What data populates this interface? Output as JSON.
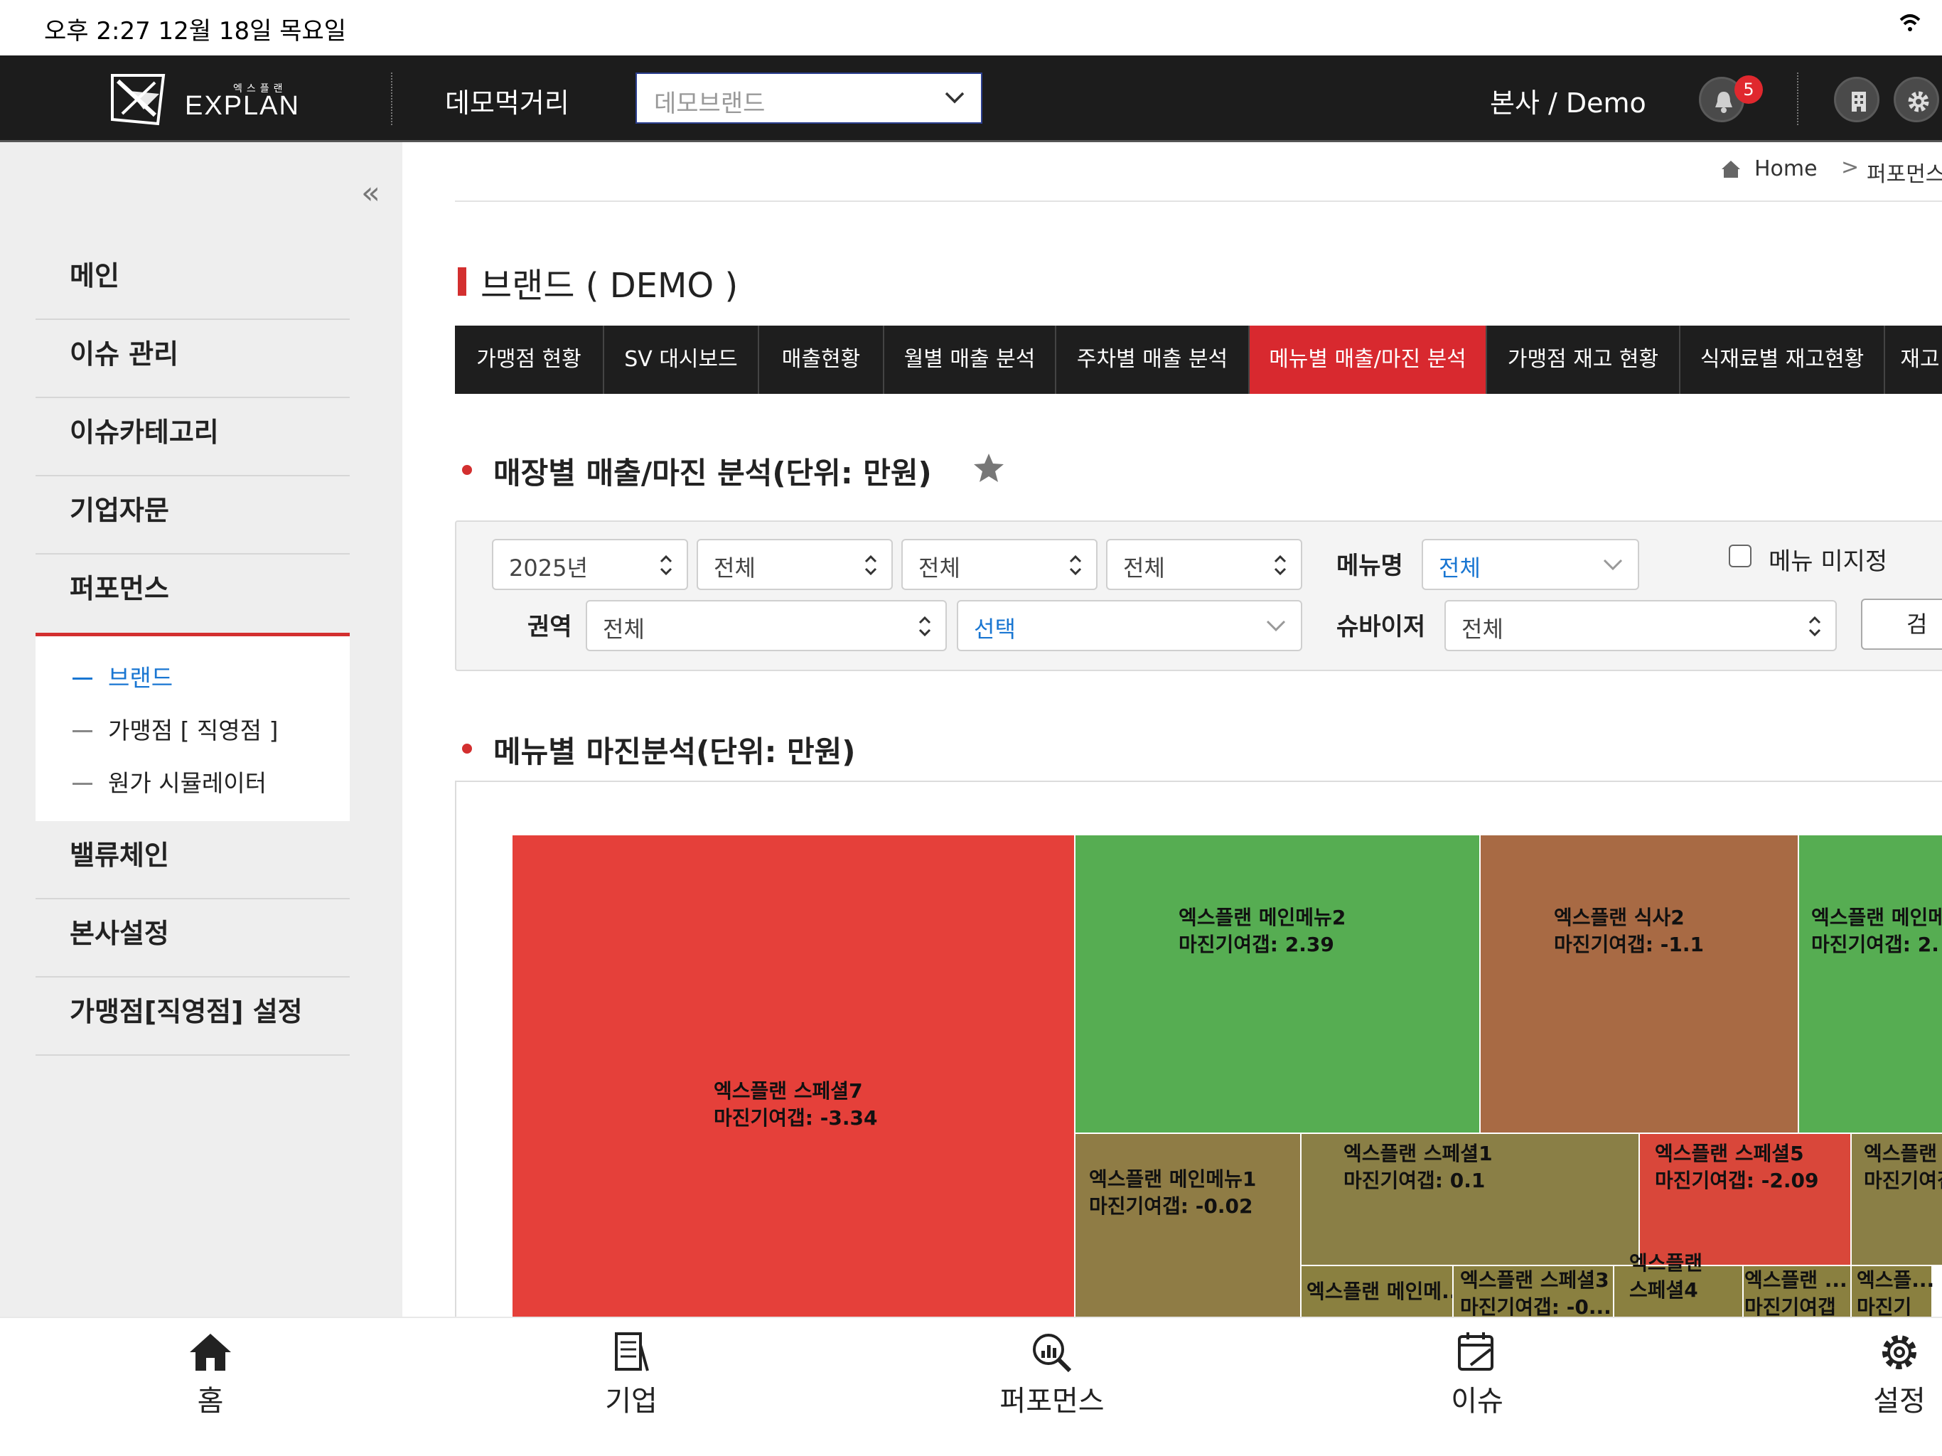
{
  "status": {
    "time": "오후 2:27   12월 18일 목요일"
  },
  "header": {
    "logo_text": "EXPLAN",
    "logo_sub": "엑스플랜",
    "store_name": "데모먹거리",
    "brand_select": {
      "value": "데모브랜드"
    },
    "org": "본사 / Demo",
    "notification_count": "5"
  },
  "sidebar": {
    "items": [
      {
        "label": "메인"
      },
      {
        "label": "이슈 관리"
      },
      {
        "label": "이슈카테고리"
      },
      {
        "label": "기업자문"
      },
      {
        "label": "퍼포먼스"
      }
    ],
    "submenu": [
      {
        "label": "브랜드",
        "active": true
      },
      {
        "label": "가맹점 [ 직영점 ]",
        "active": false
      },
      {
        "label": "원가 시뮬레이터",
        "active": false
      }
    ],
    "items_after": [
      {
        "label": "밸류체인"
      },
      {
        "label": "본사설정"
      },
      {
        "label": "가맹점[직영점] 설정"
      }
    ]
  },
  "breadcrumb": {
    "home": "Home",
    "current": "퍼포먼스"
  },
  "page_title": "브랜드 ( DEMO )",
  "tabs": [
    {
      "label": "가맹점 현황"
    },
    {
      "label": "SV 대시보드"
    },
    {
      "label": "매출현황"
    },
    {
      "label": "월별 매출 분석"
    },
    {
      "label": "주차별 매출 분석"
    },
    {
      "label": "메뉴별 매출/마진 분석",
      "active": true
    },
    {
      "label": "가맹점 재고 현황"
    },
    {
      "label": "식재료별 재고현황"
    },
    {
      "label": "재고"
    }
  ],
  "section1": {
    "title": "매장별 매출/마진 분석(단위: 만원)"
  },
  "filters": {
    "year": "2025년",
    "sel2": "전체",
    "sel3": "전체",
    "sel4": "전체",
    "menu_label": "메뉴명",
    "menu_value": "전체",
    "unassigned_label": "메뉴 미지정",
    "region_label": "권역",
    "region_value": "전체",
    "region_pick": "선택",
    "supervisor_label": "슈바이저",
    "supervisor_value": "전체",
    "search_label": "검"
  },
  "section2": {
    "title": "메뉴별 마진분석(단위: 만원)"
  },
  "colors": {
    "accent": "#d8292f",
    "header": "#1c1c1c",
    "link": "#1976d2"
  },
  "chart_data": {
    "type": "treemap",
    "value_label": "마진기여갭",
    "nodes": [
      {
        "name": "엑스플랜 스페셜7",
        "label2": "마진기여갭: -3.34",
        "value": -3.34,
        "color": "#e5403a"
      },
      {
        "name": "엑스플랜 메인메뉴2",
        "label2": "마진기여갭: 2.39",
        "value": 2.39,
        "color": "#56ad52"
      },
      {
        "name": "엑스플랜 식사2",
        "label2": "마진기여갭: -1.1",
        "value": -1.1,
        "color": "#a86a44"
      },
      {
        "name": "엑스플랜 메인메",
        "label2": "마진기여갭: 2.",
        "value": null,
        "color": "#56ad52"
      },
      {
        "name": "엑스플랜 메인메뉴1",
        "label2": "마진기여갭: -0.02",
        "value": -0.02,
        "color": "#8f7c45"
      },
      {
        "name": "엑스플랜 스페셜1",
        "label2": "마진기여갭: 0.1",
        "value": 0.1,
        "color": "#8a7f46"
      },
      {
        "name": "엑스플랜 스페셜5",
        "label2": "마진기여갭: -2.09",
        "value": -2.09,
        "color": "#d9473a"
      },
      {
        "name": "엑스플랜 스",
        "label2": "마진기여갭",
        "value": null,
        "color": "#8a7f46"
      },
      {
        "name": "엑스플랜 메인메...",
        "label2": "",
        "value": null,
        "color": "#8a8040"
      },
      {
        "name": "엑스플랜 스페셜3",
        "label2": "마진기여갭: -0...",
        "value": null,
        "color": "#8a8040"
      },
      {
        "name": "엑스플랜",
        "label2": "스페셜4",
        "value": null,
        "color": "#8a8040"
      },
      {
        "name": "엑스플랜 ...",
        "label2": "마진기여갭",
        "value": null,
        "color": "#8a8040"
      },
      {
        "name": "엑스플...",
        "label2": "마진기",
        "value": null,
        "color": "#8a8040"
      }
    ]
  },
  "bottom_nav": [
    {
      "label": "홈"
    },
    {
      "label": "기업"
    },
    {
      "label": "퍼포먼스"
    },
    {
      "label": "이슈"
    },
    {
      "label": "설정"
    }
  ]
}
